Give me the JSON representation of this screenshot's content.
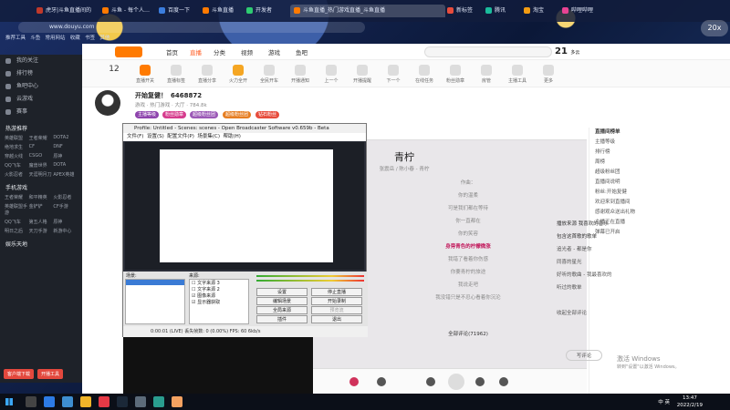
{
  "browser": {
    "tabs": [
      "虎牙|斗鱼直播间的",
      "斗鱼 - 每个人…",
      "百度一下",
      "斗鱼直播",
      "开发者",
      "视频",
      "新标签",
      "腾讯",
      "淘宝",
      "哔哩哔哩"
    ],
    "active_tab": "斗鱼直播_热门游戏直播_斗鱼直播",
    "url": "www.douyu.com",
    "bookmarks": [
      "推荐工具",
      "斗鱼",
      "常用网站",
      "收藏",
      "书签",
      "其他"
    ],
    "zoom": "20x"
  },
  "sidebar": {
    "top_items": [
      "我的关注",
      "排行榜",
      "鱼吧中心",
      "云游戏",
      "赛事"
    ],
    "section_hot": "热游推荐",
    "hot_games": [
      "英雄联盟",
      "王者荣耀",
      "DOTA2",
      "绝地求生",
      "CF",
      "DNF",
      "穿越火线",
      "CSGO",
      "原神",
      "QQ飞车",
      "魔兽世界",
      "DOTA",
      "火影忍者",
      "天涯明月刀",
      "APEX英雄"
    ],
    "section_mobile": "手机游戏",
    "mobile_games": [
      "王者荣耀",
      "和平精英",
      "火影忍者",
      "英雄联盟手游",
      "金铲铲",
      "CF手游",
      "QQ飞车",
      "第五人格",
      "原神",
      "明日之后",
      "天刀手游",
      "新游中心"
    ],
    "section_web": "娱乐天地",
    "btn_left": "客户端下载",
    "btn_right": "开播工具"
  },
  "site": {
    "nav": [
      "首页",
      "直播",
      "分类",
      "视频",
      "游戏",
      "鱼吧"
    ],
    "active_nav": "直播",
    "weather_temp": "21",
    "weather_note": "多云"
  },
  "toolbar": [
    "12",
    "直播开关",
    "直播标签",
    "直播分享",
    "火力全开",
    "全民开车",
    "开播通知",
    "上一个",
    "开播提醒",
    "下一个",
    "在线任务",
    "粉丝勋章",
    "房管",
    "主播工具",
    "更多"
  ],
  "room": {
    "title": "开始复健！",
    "id": "6468872",
    "meta": "游戏 · 热门游戏 · 大厅",
    "followers": "784.8k",
    "badges": [
      "主播等级",
      "粉丝勋章",
      "超级粉丝团",
      "超级粉丝团",
      "钻石粉丝"
    ],
    "badge_colors": [
      "#8e44ad",
      "#d63c8d",
      "#9b59b6",
      "#e67e22",
      "#e74c3c"
    ]
  },
  "chat": {
    "header": "直播间榜单",
    "rows": [
      "主播等级",
      "排行榜",
      "周榜",
      "超级粉丝团",
      "直播间说明",
      "粉丝:开始复健",
      "欢迎来到直播间",
      "感谢观众送出礼物",
      "主播正在直播",
      "弹幕已开启"
    ]
  },
  "obs": {
    "title": "Profile: Untitled - Scenes: scenes - Open Broadcaster Software v0.659b - Beta",
    "menu": [
      "文件(F)",
      "设置(S)",
      "配置文件(P)",
      "场景集(C)",
      "帮助(H)"
    ],
    "scenes_label": "场景:",
    "sources_label": "来源:",
    "sources": [
      "文字来源 3",
      "文字来源 2",
      "图像来源",
      "显示器获取"
    ],
    "buttons": [
      "设置",
      "停止直播",
      "编辑场景",
      "开始录制",
      "全局来源",
      "预览流",
      "插件",
      "退出"
    ],
    "status": "0:00:01 (LIVE)   丢失帧数: 0 (0.00%)   FPS: 60   6kb/s"
  },
  "music": {
    "song": "青柠",
    "artist": "张震岳 / 陈小春 - 青柠",
    "lyrics": [
      "青柠",
      "作曲：",
      "你的温柔",
      "可是我们都在等待",
      "你一直都在",
      "你的笑容",
      "身旁青色的柠檬微涨",
      "我错了看着你伤感",
      "你要青柠的旅途",
      "我说走吧",
      "我没错只是不忍心看着你沉沦"
    ],
    "active_line_index": 6,
    "comments_header": "播放来源 我喜欢的音乐",
    "comments": [
      "包含这首歌的歌单",
      "追光者 - 都是你",
      "同喜的星光",
      "好听的歌曲 - 我最喜欢的",
      "听过的歌单",
      "更多",
      "收起全部评论"
    ],
    "all_comments": "全部评论(71962)",
    "write_comment": "写评论"
  },
  "taskbar": {
    "tray_lang": "中 英",
    "time": "13:47",
    "date": "2022/2/19"
  },
  "activate": {
    "line1": "激活 Windows",
    "line2": "转到\"设置\"以激活 Windows。"
  }
}
